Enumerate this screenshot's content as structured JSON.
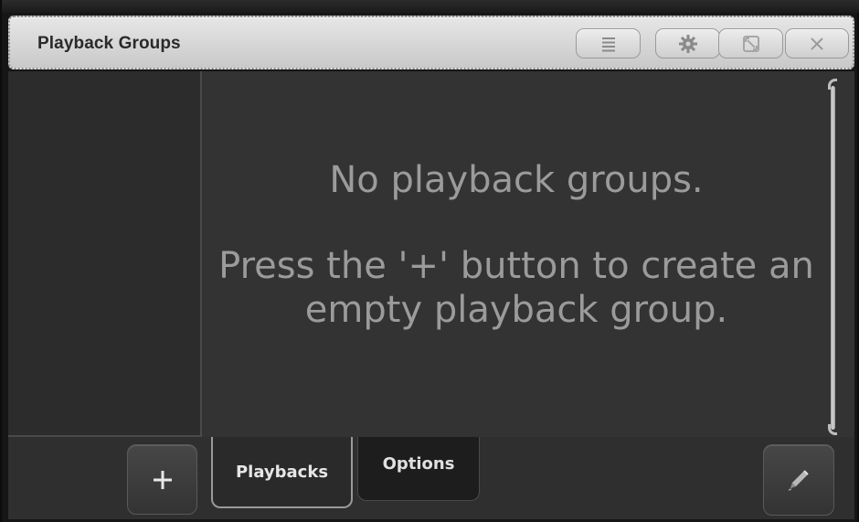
{
  "window": {
    "title": "Playback Groups",
    "buttons": [
      {
        "name": "list-icon"
      },
      {
        "name": "gear-icon"
      },
      {
        "name": "resize-icon"
      },
      {
        "name": "close-icon"
      }
    ]
  },
  "main": {
    "empty_line1": "No playback groups.",
    "empty_line2": "Press the '+' button to create an",
    "empty_line3": "empty playback group."
  },
  "bottom": {
    "add_icon": "plus-icon",
    "tabs": [
      {
        "label": "Playbacks",
        "active": true
      },
      {
        "label": "Options",
        "active": false
      }
    ],
    "edit_icon": "pencil-icon"
  },
  "colors": {
    "title_bar": "#d9d9d9",
    "content_bg": "#333333",
    "message_text": "#9b9b9b"
  }
}
